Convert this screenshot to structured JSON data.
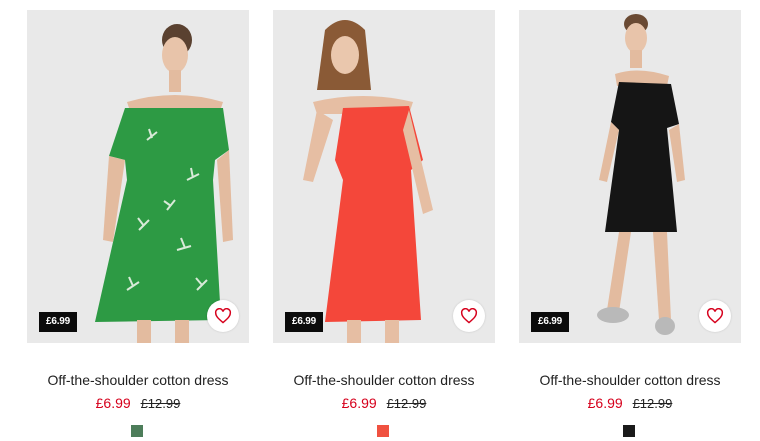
{
  "products": [
    {
      "name": "Off-the-shoulder cotton dress",
      "tag_price": "£6.99",
      "sale_price": "£6.99",
      "old_price": "£12.99",
      "swatch_color": "#4d7d5a",
      "dress_color": "#2d9a44",
      "pattern": "leaf print",
      "hair_color": "#5a4130"
    },
    {
      "name": "Off-the-shoulder cotton dress",
      "tag_price": "£6.99",
      "sale_price": "£6.99",
      "old_price": "£12.99",
      "swatch_color": "#f05140",
      "dress_color": "#f4473a",
      "pattern": "plain",
      "hair_color": "#8a5a36"
    },
    {
      "name": "Off-the-shoulder cotton dress",
      "tag_price": "£6.99",
      "sale_price": "£6.99",
      "old_price": "£12.99",
      "swatch_color": "#1a1a1a",
      "dress_color": "#151515",
      "pattern": "plain",
      "hair_color": "#6a4a33"
    }
  ],
  "icons": {
    "favourite": "heart-icon"
  },
  "colors": {
    "sale": "#d6001c",
    "tag_bg": "#0b0b0b",
    "image_bg": "#e9e9e9"
  }
}
